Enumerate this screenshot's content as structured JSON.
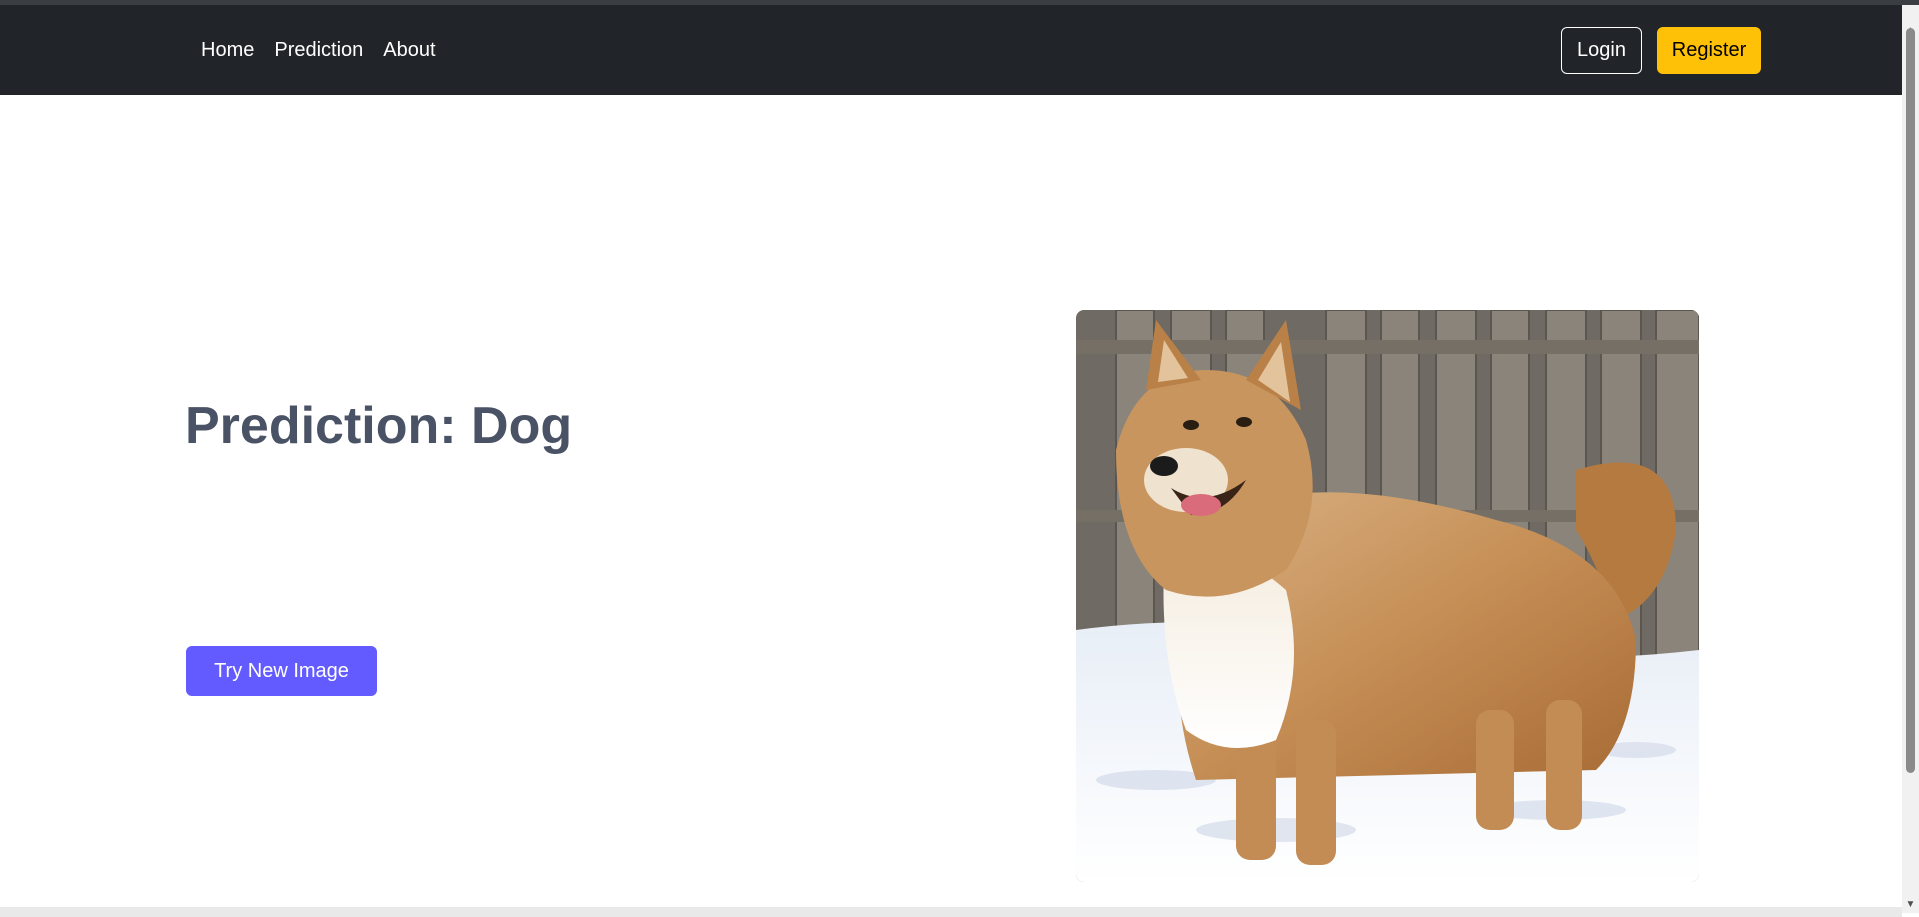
{
  "navbar": {
    "links": [
      {
        "label": "Home"
      },
      {
        "label": "Prediction"
      },
      {
        "label": "About"
      }
    ],
    "login_label": "Login",
    "register_label": "Register"
  },
  "main": {
    "prediction_text": "Prediction: Dog",
    "try_button_label": "Try New Image",
    "image": {
      "subject": "dog standing in snow in front of a wooden fence"
    }
  },
  "colors": {
    "navbar_bg": "#212529",
    "register_bg": "#ffc107",
    "try_button_bg": "#635bff",
    "heading_text": "#4a5366"
  }
}
